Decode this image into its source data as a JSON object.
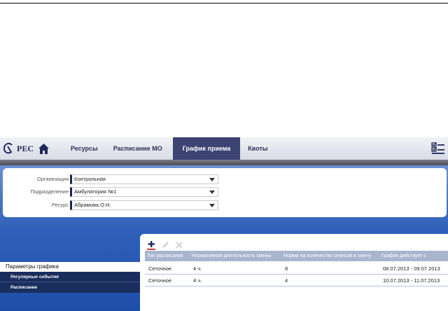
{
  "app": {
    "logo_text": "РЕС"
  },
  "nav": {
    "items": [
      {
        "label": "Ресурсы",
        "active": false
      },
      {
        "label": "Расписание МО",
        "active": false
      },
      {
        "label": "График приема",
        "active": true
      },
      {
        "label": "Квоты",
        "active": false
      }
    ]
  },
  "filters": {
    "organization": {
      "label": "Организация",
      "value": "Контрольная"
    },
    "department": {
      "label": "Подразделение",
      "value": "Амбулатория №1"
    },
    "resource": {
      "label": "Ресурс",
      "value": "Абрамова О.Н."
    }
  },
  "sidebar": {
    "title": "Параметры графика",
    "items": [
      {
        "label": "Регулярные события"
      },
      {
        "label": "Расписание"
      }
    ]
  },
  "table": {
    "columns": [
      "Тип расписания",
      "Нормативная длительность смены",
      "Норма на количество сеансов в смену",
      "График действует с"
    ],
    "rows": [
      [
        "Сеточное",
        "4 ч.",
        "8",
        "08.07.2013 - 09.07.2013"
      ],
      [
        "Сеточное",
        "4 ч.",
        "4",
        "10.07.2013 - 11.07.2013"
      ]
    ]
  },
  "colors": {
    "nav_active": "#3d4373",
    "sidebar_bg": "#1a2e5e",
    "accent_blue": "#2e5fb9",
    "add_underline": "#c62828"
  },
  "icons": {
    "home": "home-icon",
    "menu": "checklist-icon",
    "add": "add-icon",
    "edit": "pencil-icon",
    "delete": "close-icon"
  }
}
